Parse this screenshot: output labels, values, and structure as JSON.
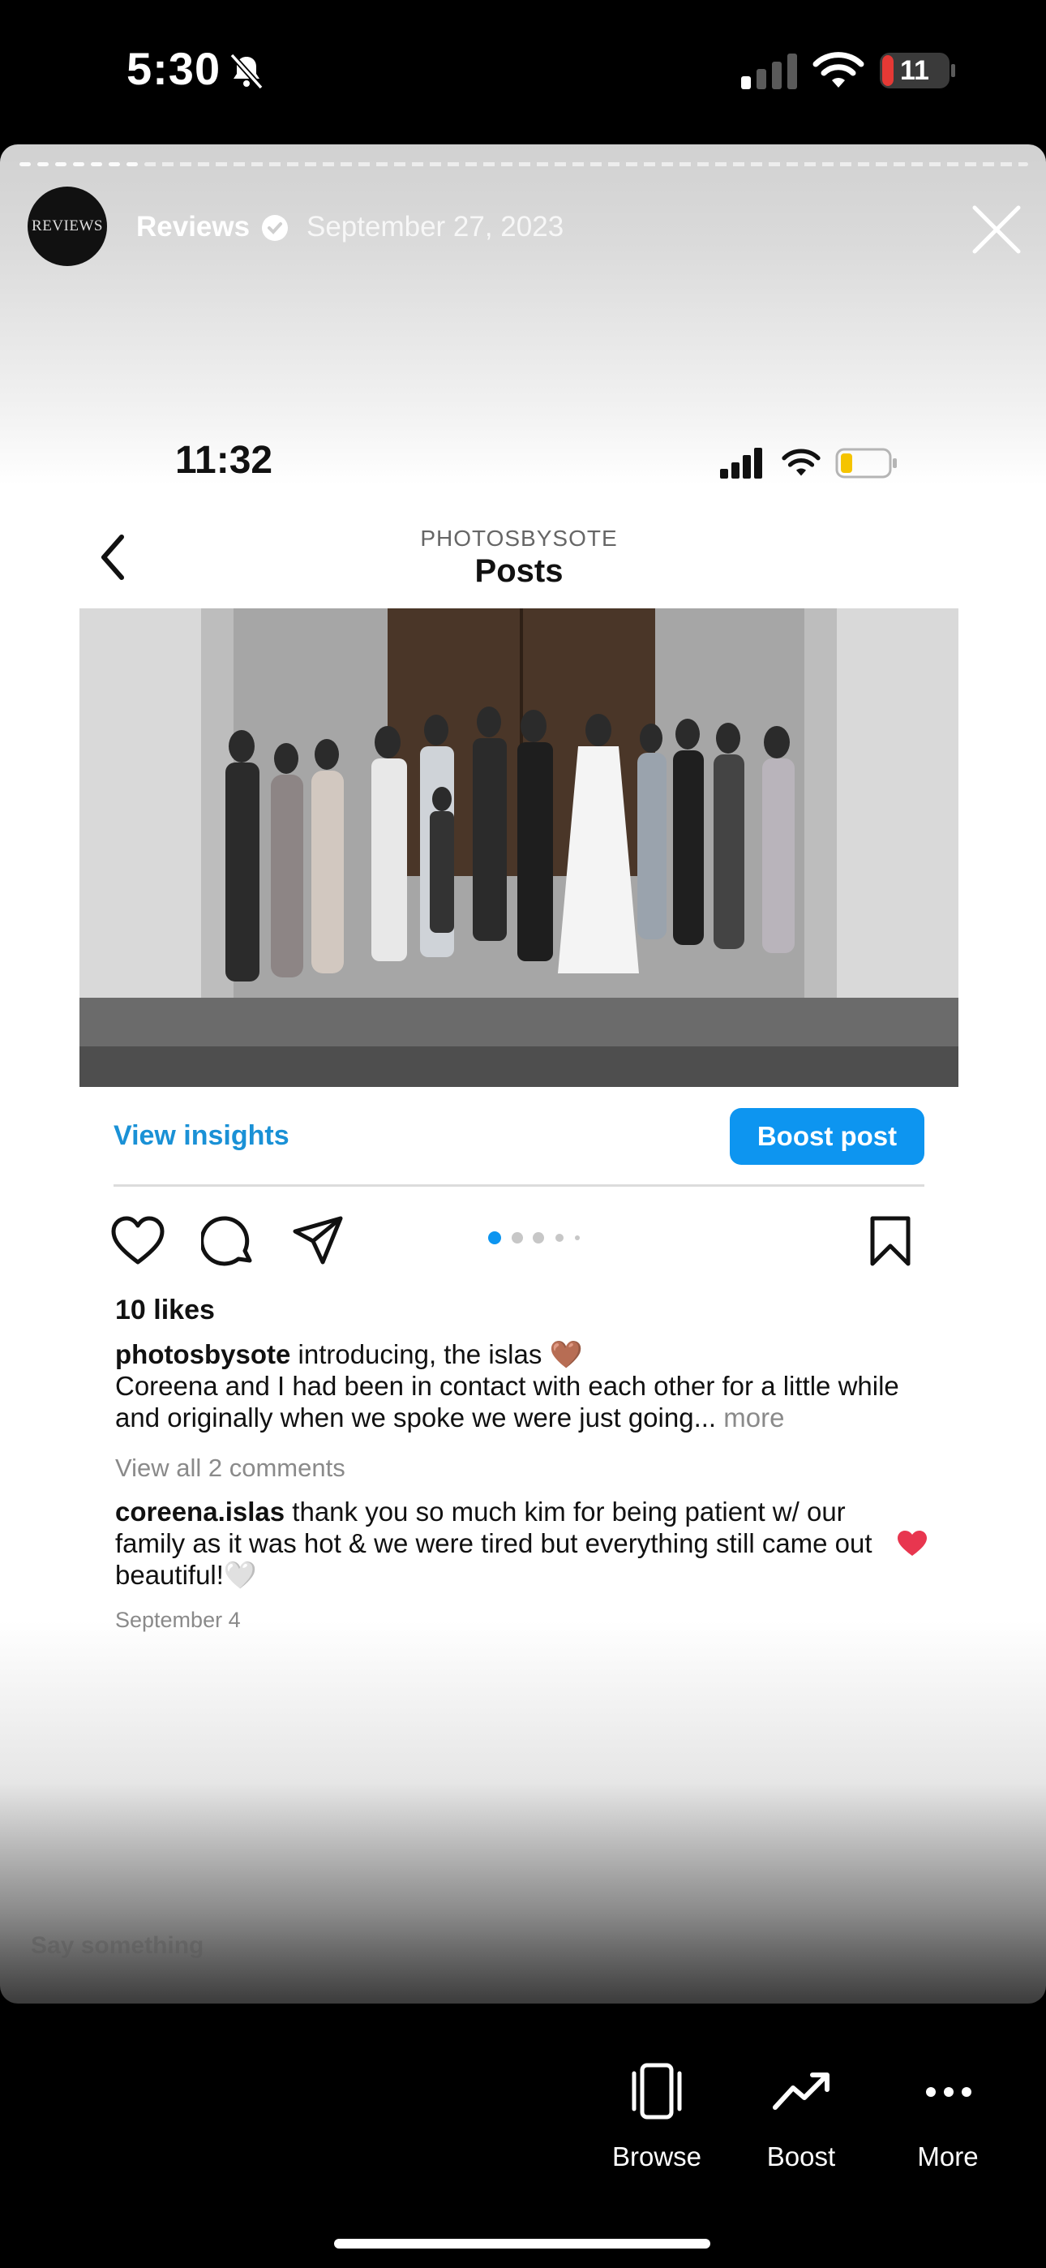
{
  "status_bar": {
    "time": "5:30",
    "battery": "11"
  },
  "story": {
    "account": "Reviews",
    "avatar_text": "REVIEWS",
    "date": "September 27, 2023",
    "reply_placeholder": "Say something"
  },
  "inner": {
    "time": "11:32",
    "account_caption": "PHOTOSBYSOTE",
    "title": "Posts",
    "view_insights": "View insights",
    "boost_post": "Boost post",
    "likes": "10 likes",
    "caption_user": "photosbysote",
    "caption_text": " introducing, the islas 🤎",
    "caption_body": "Coreena and I had been in contact with each other for a little while and originally when we spoke we were just going...",
    "more": " more",
    "view_comments": "View all 2 comments",
    "comment_user": "coreena.islas",
    "comment_text": " thank you so much kim for being patient w/ our family as it was hot & we were tired but everything still came out beautiful!🤍",
    "post_date": "September 4"
  },
  "bottom_nav": {
    "browse": "Browse",
    "boost": "Boost",
    "more": "More"
  },
  "colors": {
    "accent_blue": "#0d95f0",
    "link_blue": "#1a91d6",
    "battery_red": "#e53935",
    "heart_red": "#e8364f"
  }
}
